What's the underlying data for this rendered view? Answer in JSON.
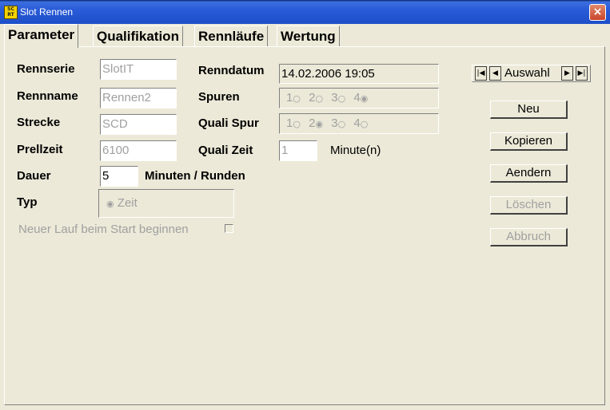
{
  "window": {
    "title": "Slot Rennen",
    "icon": "app-icon",
    "close": "×"
  },
  "tabs": [
    "Parameter",
    "Qualifikation",
    "Rennläufe",
    "Wertung"
  ],
  "form": {
    "rennserie": {
      "label": "Rennserie",
      "value": "SlotIT"
    },
    "rennname": {
      "label": "Rennname",
      "value": "Rennen2"
    },
    "strecke": {
      "label": "Strecke",
      "value": "SCD"
    },
    "prellzeit": {
      "label": "Prellzeit",
      "value": "6100"
    },
    "dauer": {
      "label": "Dauer",
      "value": "5",
      "unit": "Minuten / Runden"
    },
    "typ": {
      "label": "Typ",
      "selected": "Zeit"
    },
    "neuer_lauf": {
      "label": "Neuer Lauf beim Start beginnen",
      "checked": false
    },
    "renndatum": {
      "label": "Renndatum",
      "value": "14.02.2006 19:05"
    },
    "spuren": {
      "label": "Spuren",
      "options": [
        "1",
        "2",
        "3",
        "4"
      ],
      "selected": "4"
    },
    "quali_spur": {
      "label": "Quali Spur",
      "options": [
        "1",
        "2",
        "3",
        "4"
      ],
      "selected": "2"
    },
    "quali_zeit": {
      "label": "Quali Zeit",
      "value": "1",
      "unit": "Minute(n)"
    }
  },
  "navigator": {
    "label": "Auswahl"
  },
  "buttons": {
    "neu": "Neu",
    "kopieren": "Kopieren",
    "aendern": "Aendern",
    "loeschen": "Löschen",
    "abbruch": "Abbruch"
  }
}
